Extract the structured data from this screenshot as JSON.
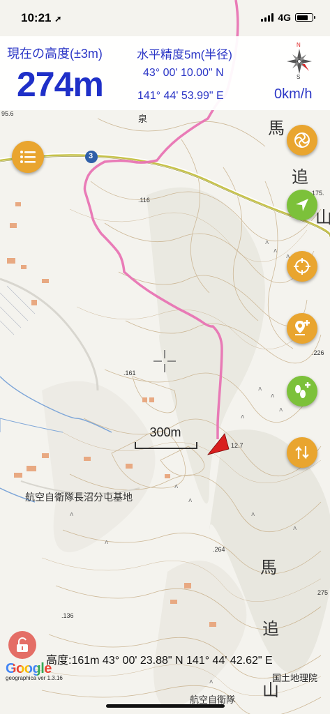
{
  "status": {
    "time": "10:21",
    "network": "4G"
  },
  "header": {
    "altitude_label": "現在の高度(±3m)",
    "altitude_value": "274m",
    "accuracy_label": "水平精度5m(半径)",
    "latitude": "43° 00' 10.00\" N",
    "longitude": "141° 44' 53.99\" E",
    "speed": "0km/h",
    "compass": {
      "n": "N",
      "s": "S"
    }
  },
  "map": {
    "scale_label": "300m",
    "place_labels": {
      "base": "航空自衛隊長沼分屯基地",
      "base_bottom": "航空自衛隊",
      "ba1": "馬",
      "oi1": "追",
      "yama1": "山",
      "ba2": "馬",
      "oi2": "追",
      "yama2": "山",
      "izumi": "泉",
      "route": "3"
    },
    "elevations": {
      "e95": "95.6",
      "e116": ".116",
      "e175": "175.",
      "e161": ".161",
      "e226": ".226",
      "e127": "12.7",
      "e264": ".264",
      "e275": "275",
      "e136": ".136"
    }
  },
  "cursor_info": "高度:161m  43° 00' 23.88\" N 141° 44' 42.62\" E",
  "attribution": {
    "google": "Google",
    "version": "geographica ver 1.3.16",
    "gsi": "国土地理院"
  },
  "buttons": [
    "menu",
    "compass-mode",
    "location",
    "target",
    "add-waypoint",
    "add-track",
    "navigate"
  ]
}
